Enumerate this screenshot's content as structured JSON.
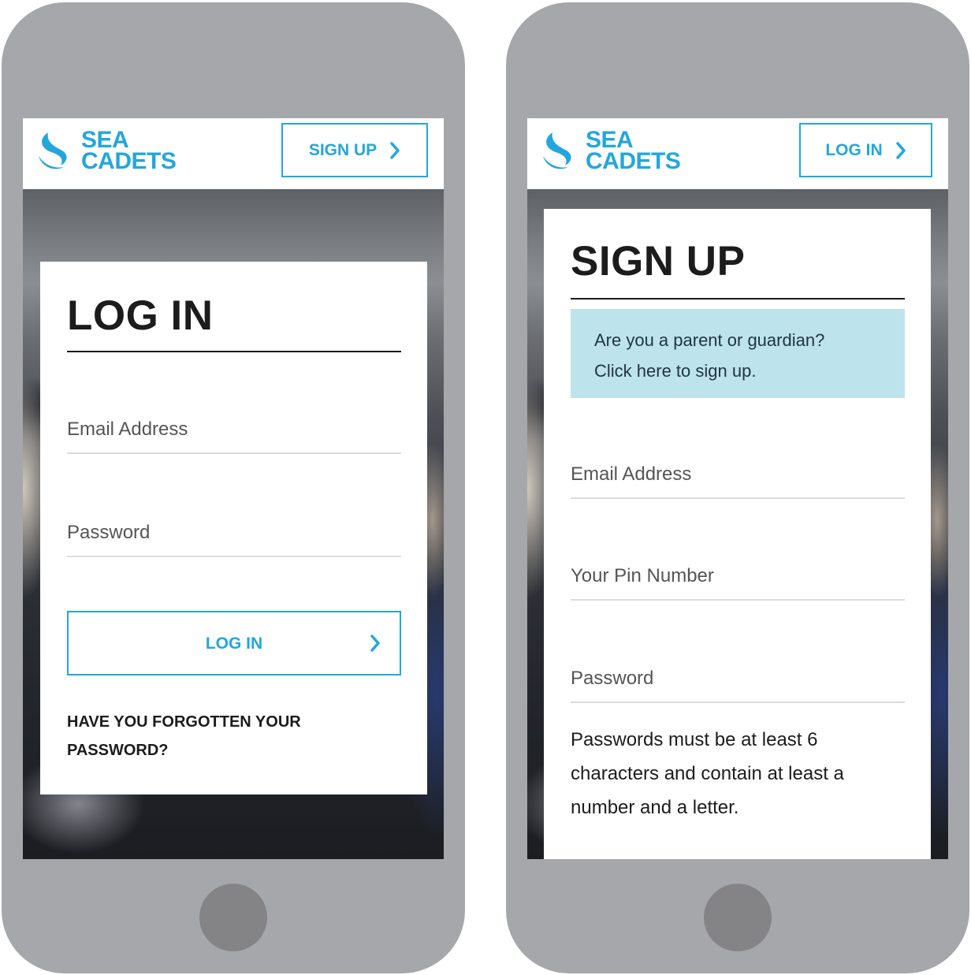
{
  "brand": {
    "line1": "SEA",
    "line2": "CADETS",
    "color": "#22a7dc"
  },
  "login_screen": {
    "header_button": "SIGN UP",
    "title": "LOG IN",
    "email_placeholder": "Email Address",
    "password_placeholder": "Password",
    "submit_label": "LOG IN",
    "forgot_line1": "HAVE YOU FORGOTTEN YOUR",
    "forgot_line2": "PASSWORD?"
  },
  "signup_screen": {
    "header_button": "LOG IN",
    "title": "SIGN UP",
    "parent_line1": "Are you a parent or guardian?",
    "parent_line2": "Click here to sign up.",
    "email_placeholder": "Email Address",
    "pin_placeholder": "Your Pin Number",
    "password_placeholder": "Password",
    "hint_line1": "Passwords must be at least 6",
    "hint_line2": "characters and contain at least a",
    "hint_line3": "number and a letter."
  },
  "icons": {
    "logo": "sea-cadets-wave-logo",
    "chevron": "chevron-right-icon",
    "home": "home-button"
  },
  "colors": {
    "accent": "#22a7dc",
    "phone_body": "#a6a7aa",
    "home_button": "#848487",
    "info_box": "#bde3ec"
  }
}
